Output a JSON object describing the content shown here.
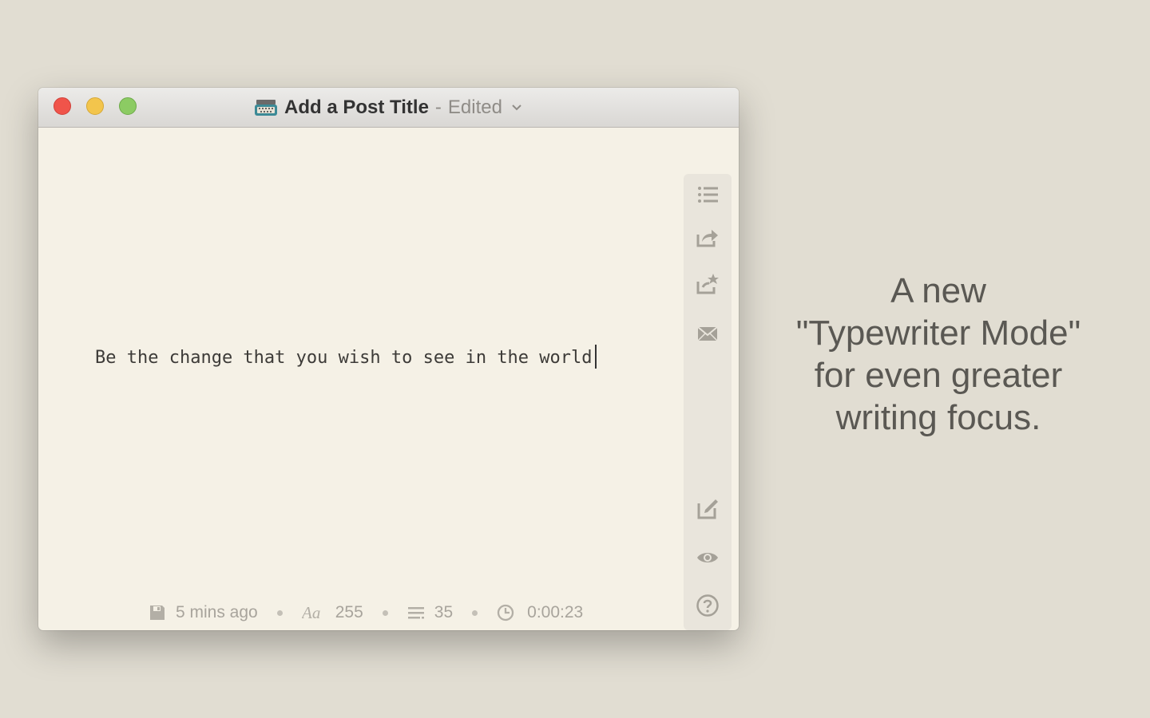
{
  "window": {
    "title": "Add a Post Title",
    "separator": "-",
    "status": "Edited"
  },
  "editor": {
    "text": "Be the change that you wish to see in the world"
  },
  "sidebar": {
    "top_buttons": [
      "outline",
      "share",
      "publish",
      "email"
    ],
    "bottom_buttons": [
      "edit",
      "preview",
      "help"
    ]
  },
  "statusbar": {
    "saved": "5 mins ago",
    "characters": "255",
    "lines": "35",
    "time": "0:00:23"
  },
  "promo": {
    "lines": [
      "A new",
      "\"Typewriter Mode\"",
      "for even greater",
      "writing focus."
    ]
  },
  "colors": {
    "background": "#e1ddd2",
    "editor_background": "#f5f1e6",
    "close": "#f0544a",
    "minimize": "#f3c54c",
    "zoom": "#8ccb63"
  }
}
